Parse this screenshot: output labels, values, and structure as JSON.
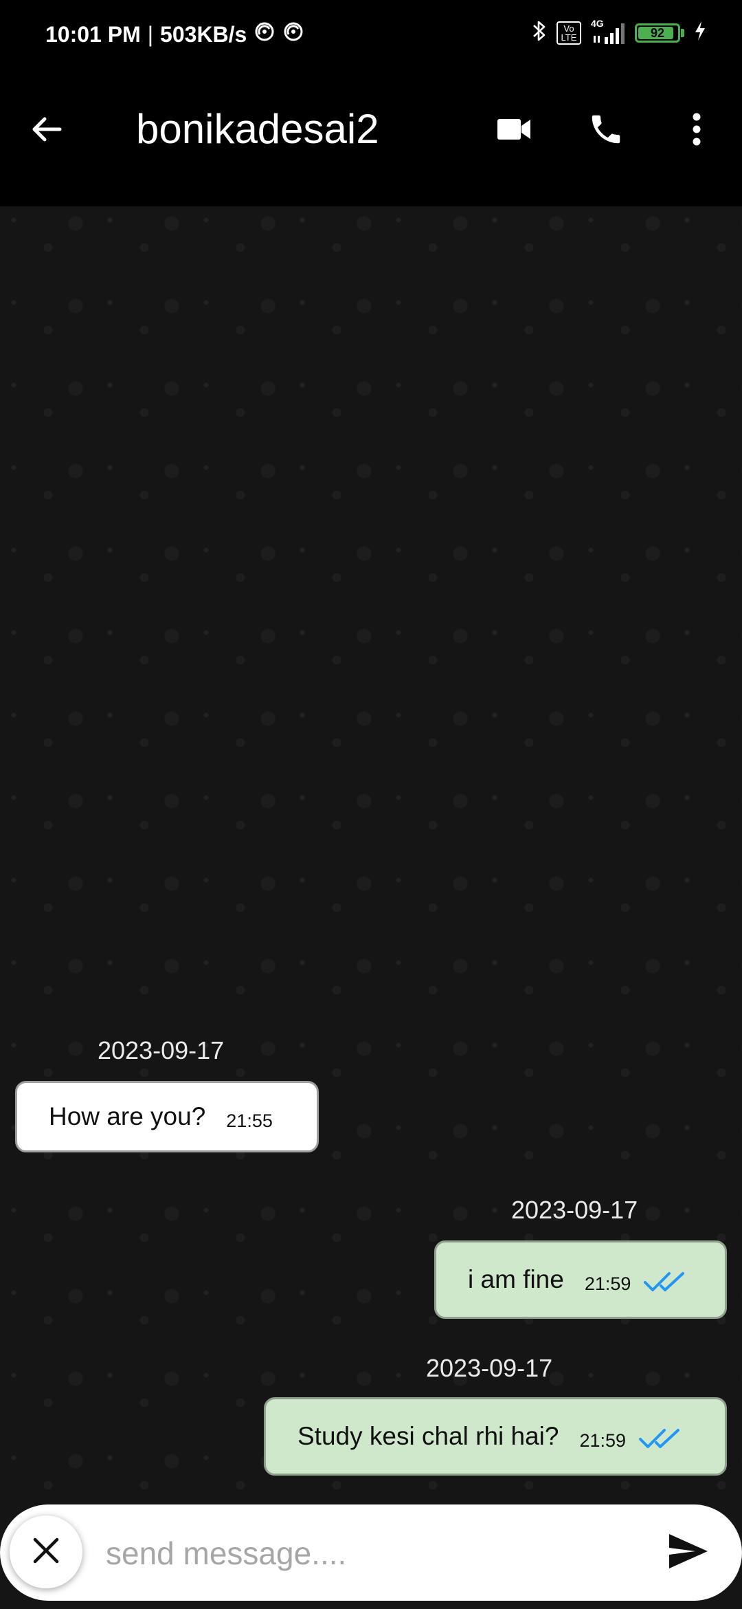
{
  "status_bar": {
    "time": "10:01 PM",
    "network_speed": "503KB/s",
    "volte_label": "Vo LTE",
    "network_type": "4G",
    "battery_level": "92",
    "battery_fraction": 0.92,
    "icons": [
      "dnd-icon",
      "vpn-icon",
      "bluetooth-icon",
      "volte-icon",
      "signal-icon",
      "battery-icon",
      "charging-icon"
    ]
  },
  "header": {
    "contact_name": "bonikadesai2",
    "icons": [
      "back-arrow-icon",
      "video-call-icon",
      "phone-icon",
      "more-vertical-icon"
    ]
  },
  "messages": [
    {
      "direction": "incoming",
      "date": "2023-09-17",
      "text": "How are you?",
      "time": "21:55",
      "read": false
    },
    {
      "direction": "outgoing",
      "date": "2023-09-17",
      "text": "i am fine",
      "time": "21:59",
      "read": true
    },
    {
      "direction": "outgoing",
      "date": "2023-09-17",
      "text": "Study kesi chal rhi hai?",
      "time": "21:59",
      "read": true
    }
  ],
  "composer": {
    "placeholder": "send message....",
    "value": "",
    "icons": [
      "close-icon",
      "send-icon"
    ]
  },
  "colors": {
    "chat_background": "#151515",
    "incoming_bubble": "#ffffff",
    "outgoing_bubble": "#cfe8cb",
    "read_tick": "#2196f3",
    "battery": "#4caf50"
  }
}
